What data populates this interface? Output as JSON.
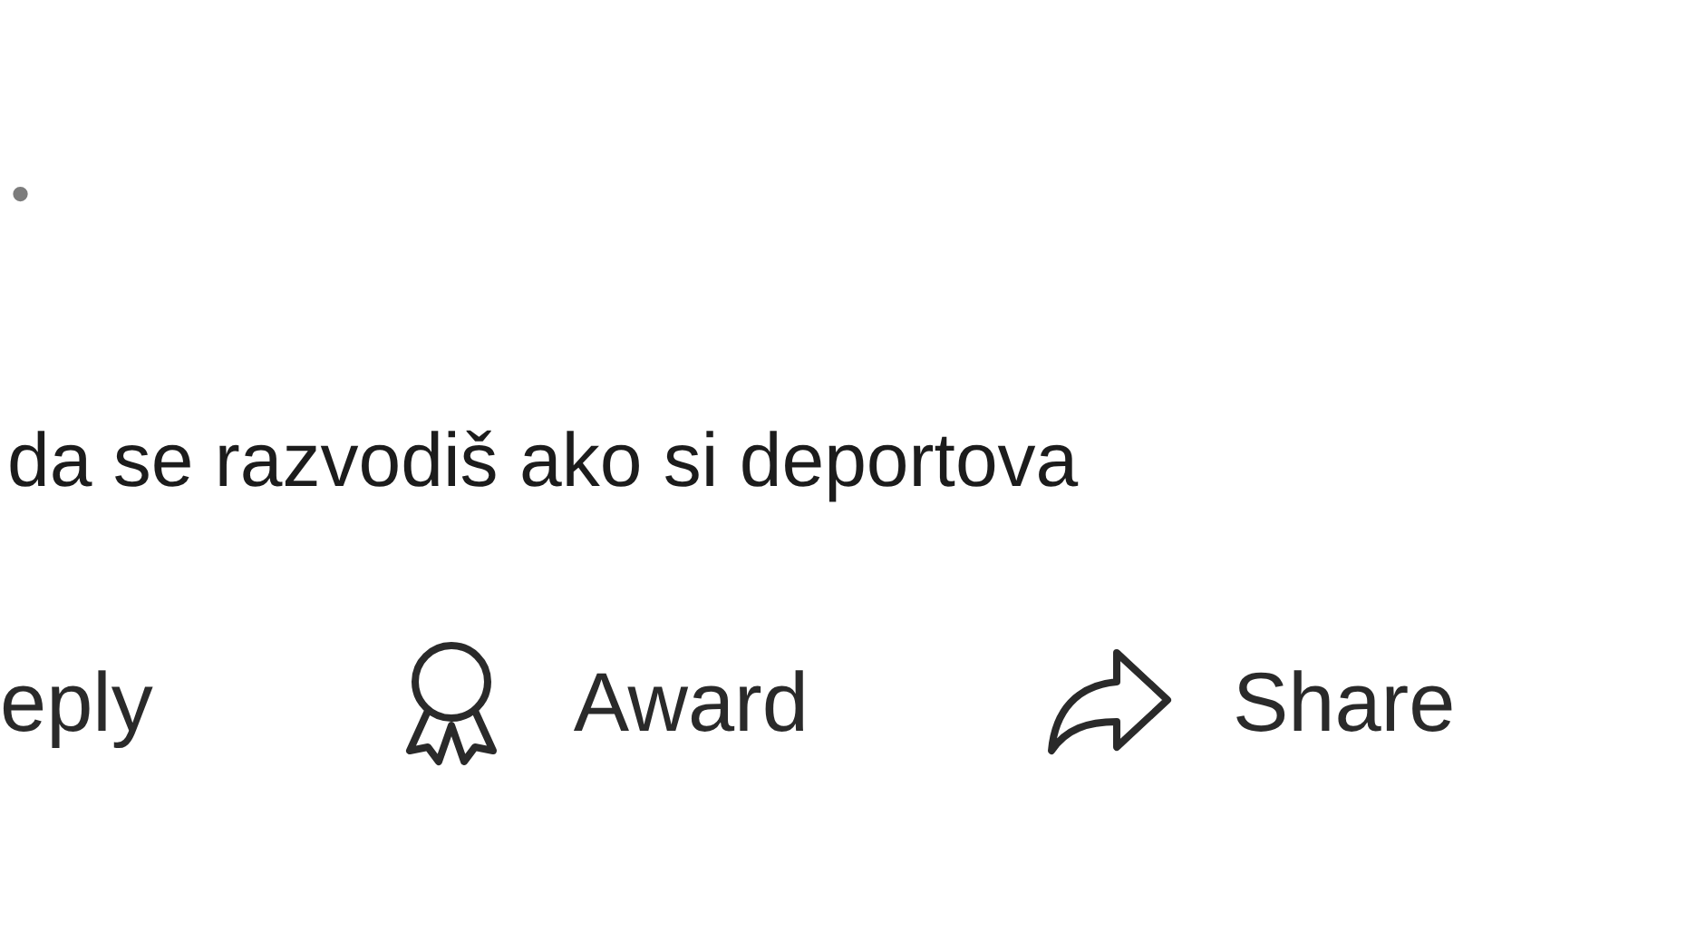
{
  "meta_separator": "•",
  "comment": {
    "text": "da se razvodiš ako si deportova"
  },
  "actions": [
    {
      "kind": "reply",
      "label": "eply"
    },
    {
      "kind": "award",
      "label": "Award"
    },
    {
      "kind": "share",
      "label": "Share"
    }
  ]
}
